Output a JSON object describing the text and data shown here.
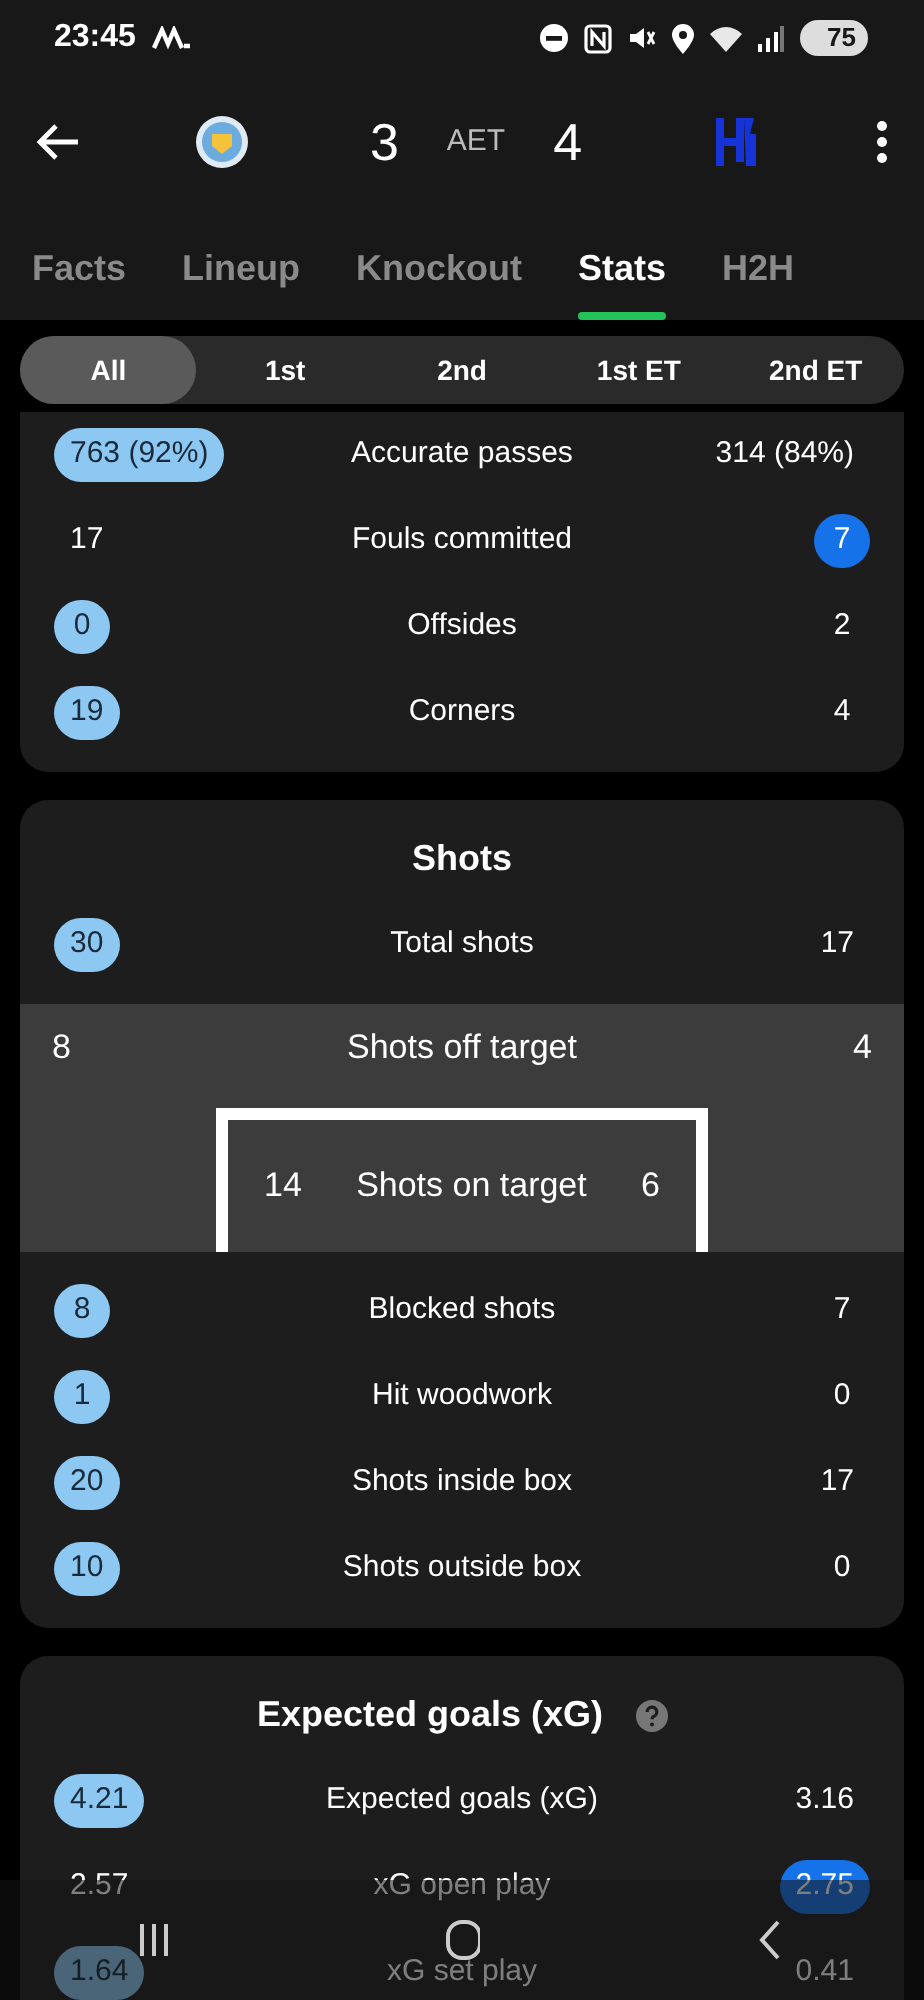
{
  "status_bar": {
    "time": "23:45",
    "battery": "75"
  },
  "header": {
    "home_score": "3",
    "status": "AET",
    "away_score": "4"
  },
  "tabs": [
    {
      "label": "Facts",
      "selected": false
    },
    {
      "label": "Lineup",
      "selected": false
    },
    {
      "label": "Knockout",
      "selected": false
    },
    {
      "label": "Stats",
      "selected": true
    },
    {
      "label": "H2H",
      "selected": false
    }
  ],
  "period_filters": [
    {
      "label": "All",
      "selected": true
    },
    {
      "label": "1st",
      "selected": false
    },
    {
      "label": "2nd",
      "selected": false
    },
    {
      "label": "1st ET",
      "selected": false
    },
    {
      "label": "2nd ET",
      "selected": false
    }
  ],
  "sections": [
    {
      "rows": [
        {
          "kind": "stat",
          "home": "763 (92%)",
          "label": "Accurate passes",
          "away": "314 (84%)",
          "home_highlighted": true,
          "away_highlighted": false
        },
        {
          "kind": "stat",
          "home": "17",
          "label": "Fouls committed",
          "away": "7",
          "home_highlighted": false,
          "away_highlighted": true
        },
        {
          "kind": "stat",
          "home": "0",
          "label": "Offsides",
          "away": "2",
          "home_highlighted": true,
          "away_highlighted": false
        },
        {
          "kind": "stat",
          "home": "19",
          "label": "Corners",
          "away": "4",
          "home_highlighted": true,
          "away_highlighted": false
        }
      ]
    },
    {
      "title": "Shots",
      "rows": [
        {
          "kind": "stat",
          "home": "30",
          "label": "Total shots",
          "away": "17",
          "home_highlighted": true,
          "away_highlighted": false
        },
        {
          "kind": "target",
          "off": {
            "home": "8",
            "label": "Shots off target",
            "away": "4"
          },
          "on": {
            "home": "14",
            "label": "Shots on target",
            "away": "6"
          }
        },
        {
          "kind": "stat",
          "home": "8",
          "label": "Blocked shots",
          "away": "7",
          "home_highlighted": true,
          "away_highlighted": false
        },
        {
          "kind": "stat",
          "home": "1",
          "label": "Hit woodwork",
          "away": "0",
          "home_highlighted": true,
          "away_highlighted": false
        },
        {
          "kind": "stat",
          "home": "20",
          "label": "Shots inside box",
          "away": "17",
          "home_highlighted": true,
          "away_highlighted": false
        },
        {
          "kind": "stat",
          "home": "10",
          "label": "Shots outside box",
          "away": "0",
          "home_highlighted": true,
          "away_highlighted": false
        }
      ]
    },
    {
      "title": "Expected goals (xG)",
      "info": true,
      "rows": [
        {
          "kind": "stat",
          "home": "4.21",
          "label": "Expected goals (xG)",
          "away": "3.16",
          "home_highlighted": true,
          "away_highlighted": false
        },
        {
          "kind": "stat",
          "home": "2.57",
          "label": "xG open play",
          "away": "2.75",
          "home_highlighted": false,
          "away_highlighted": true
        },
        {
          "kind": "stat",
          "home": "1.64",
          "label": "xG set play",
          "away": "0.41",
          "home_highlighted": true,
          "away_highlighted": false
        }
      ]
    }
  ]
}
